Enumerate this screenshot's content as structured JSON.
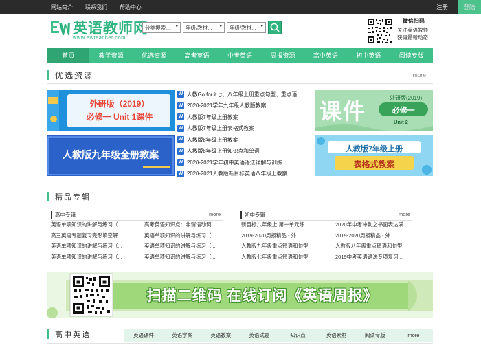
{
  "topbar": {
    "links": [
      "网站简介",
      "联系我们",
      "帮助中心"
    ],
    "register": "注册",
    "login": "登陆"
  },
  "header": {
    "logo_title": "英语教师网",
    "logo_url": "www.ewteacher.com",
    "selects": [
      "分类搜索...",
      "年级/教材...",
      "年级/教材..."
    ],
    "wechat_title": "微信扫码",
    "wechat_line1": "关注英语教师",
    "wechat_line2": "获得最新动态"
  },
  "nav": {
    "items": [
      "首页",
      "教学资源",
      "优选资源",
      "高考英语",
      "中考英语",
      "周报资源",
      "高中英语",
      "初中英语",
      "阅读专版"
    ]
  },
  "featured": {
    "title": "优选资源",
    "more": "more",
    "items": [
      "人教Go for it七、八年级上册重点句型、重点语...",
      "2020-2021学年九年级人教版教案",
      "人教版7年级上册教案",
      "人教版7年级上册表格式教案",
      "人教版8年级上册教案",
      "人教版8年级上册知识点和单词",
      "2020-2021学年初中英语语法详解与训练",
      "2020-2021人教版新目标英语八年级上教案"
    ],
    "banner1_line1": "外研版（2019）",
    "banner1_line2": "必修一 Unit 1课件",
    "banner2_text": "人教版九年级全册教案",
    "banner3_big": "课件",
    "banner3_edition": "外研版(2019)",
    "banner3_sub": "必修一",
    "banner3_unit": "Unit 2",
    "banner4_line1": "人教版7年级上册",
    "banner4_line2": "表格式教案"
  },
  "special": {
    "title": "精品专辑",
    "high_head": "高中专辑",
    "high_more": "more",
    "mid_head": "初中专辑",
    "mid_more": "more",
    "col1": [
      "英语单项知识的讲解与练习（...",
      "高三英语专题复习完形填空解...",
      "英语单项知识的讲解与练习（...",
      "英语单项知识的讲解与练习（..."
    ],
    "col2": [
      "高考英语知识点：非谓语动词",
      "英语单项知识的讲解与练习（...",
      "英语单项知识的讲解与练习（...",
      "英语单项知识的讲解与练习（..."
    ],
    "col3": [
      "新目标八年级上 第一单元练...",
      "2019-2020周报精品 - 外...",
      "人教版九年级重点短语和句型",
      "人教版七年级重点短语和句型"
    ],
    "col4": [
      "2020年中考冲刺之书面表达满...",
      "2019-2020周报精品 - 外...",
      "人教版八年级重点短语和句型",
      "2019中考英语语法专项复习..."
    ]
  },
  "qr_banner": {
    "text": "扫描二维码 在线订阅《英语周报》"
  },
  "high_school": {
    "title": "高中英语",
    "tabs": [
      "英语课件",
      "英语学案",
      "英语教案",
      "英语试题",
      "知识点",
      "英语素材",
      "阅读专版",
      "more"
    ]
  },
  "colors": {
    "accent": "#3fbf8a",
    "accent_dark": "#2fa574",
    "topbar": "#2b2b2b",
    "word_icon": "#2a6fd0"
  }
}
